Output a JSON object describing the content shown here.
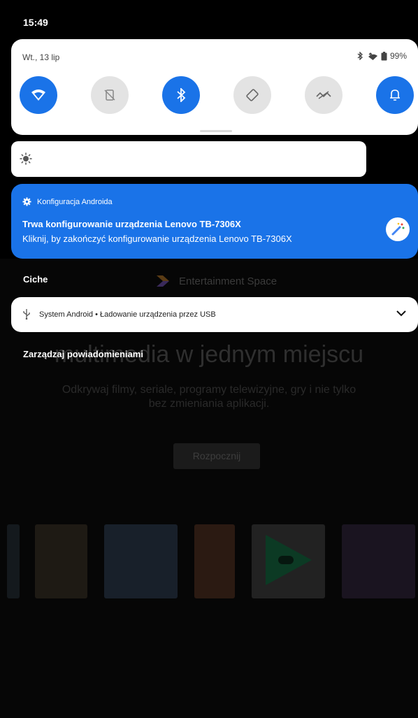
{
  "status_bar": {
    "time": "15:49"
  },
  "quick_settings": {
    "date": "Wt., 13 lip",
    "battery": "99%",
    "tiles": [
      "wifi",
      "rotation-lock",
      "bluetooth",
      "auto-rotate",
      "data-saver",
      "notification-bell"
    ]
  },
  "notifications": {
    "setup": {
      "app_name": "Konfiguracja Androida",
      "title": "Trwa konfigurowanie urządzenia Lenovo TB-7306X",
      "text": "Kliknij, by zakończyć konfigurowanie urządzenia Lenovo TB-7306X"
    },
    "silent_header": "Ciche",
    "usb": {
      "text": "System Android • Ładowanie urządzenia przez USB"
    },
    "manage_label": "Zarządzaj powiadomieniami"
  },
  "background": {
    "brand": "Entertainment Space",
    "headline": "multimedia w jednym miejscu",
    "subtitle_1": "Odkrywaj filmy, seriale, programy telewizyjne, gry i nie tylko",
    "subtitle_2": "bez zmieniania aplikacji.",
    "start_label": "Rozpocznij"
  },
  "colors": {
    "accent": "#1a73e8",
    "tile_off": "#e3e3e3",
    "panel": "#ffffff"
  }
}
